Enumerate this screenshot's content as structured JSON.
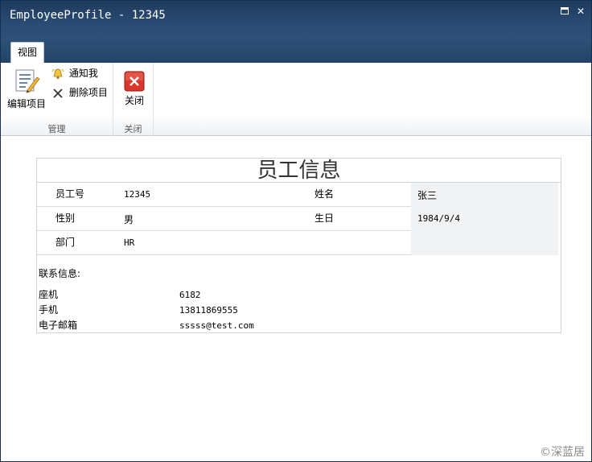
{
  "window": {
    "title": "EmployeeProfile - 12345",
    "maximize_icon": "maximize-icon",
    "close_glyph": "✕"
  },
  "tabs": [
    {
      "label": "视图",
      "active": true
    }
  ],
  "ribbon": {
    "groups": [
      {
        "label": "管理",
        "buttons": [
          {
            "label": "编辑项目",
            "icon": "edit-item-icon"
          },
          {
            "label": "通知我",
            "icon": "alert-bell-icon"
          },
          {
            "label": "删除项目",
            "icon": "delete-x-icon"
          }
        ]
      },
      {
        "label": "关闭",
        "buttons": [
          {
            "label": "关闭",
            "icon": "close-red-icon"
          }
        ]
      }
    ]
  },
  "form": {
    "title": "员工信息",
    "fields": {
      "employee_id_label": "员工号",
      "employee_id_value": "12345",
      "name_label": "姓名",
      "name_value": "张三",
      "gender_label": "性别",
      "gender_value": "男",
      "birthday_label": "生日",
      "birthday_value": "1984/9/4",
      "department_label": "部门",
      "department_value": "HR"
    },
    "contact": {
      "heading": "联系信息:",
      "rows": [
        {
          "label": "座机",
          "value": "6182"
        },
        {
          "label": "手机",
          "value": "13811869555"
        },
        {
          "label": "电子邮箱",
          "value": "sssss@test.com"
        }
      ]
    }
  },
  "watermark": "©深蓝居",
  "colors": {
    "titlebar": "#1f3b5e",
    "close_button_red": "#d9372b"
  }
}
